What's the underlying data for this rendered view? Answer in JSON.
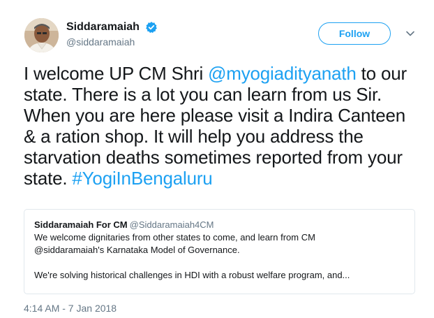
{
  "author": {
    "display_name": "Siddaramaiah",
    "handle": "@siddaramaiah",
    "verified_icon": "verified-badge-icon",
    "avatar_icon": "profile-photo"
  },
  "actions": {
    "follow_label": "Follow",
    "menu_icon": "chevron-down-icon"
  },
  "tweet": {
    "text_part1": "I welcome UP CM Shri ",
    "mention": "@myogiadityanath",
    "text_part2": " to our state. There is a lot you can learn from us Sir. When you are here please visit a Indira Canteen & a ration shop. It will help you address the starvation deaths sometimes reported from your state. ",
    "hashtag": "#YogiInBengaluru"
  },
  "quoted_tweet": {
    "display_name": "Siddaramaiah For CM",
    "handle": "@Siddaramaiah4CM",
    "line1": "We welcome dignitaries from other states to come, and learn from CM",
    "line2": "@siddaramaiah's Karnataka Model of Governance.",
    "line3": "We're solving historical challenges in HDI with a robust welfare program, and..."
  },
  "timestamp": "4:14 AM - 7 Jan 2018",
  "colors": {
    "accent": "#1da1f2",
    "text": "#14171a",
    "secondary": "#657786",
    "border": "#e1e8ed"
  }
}
